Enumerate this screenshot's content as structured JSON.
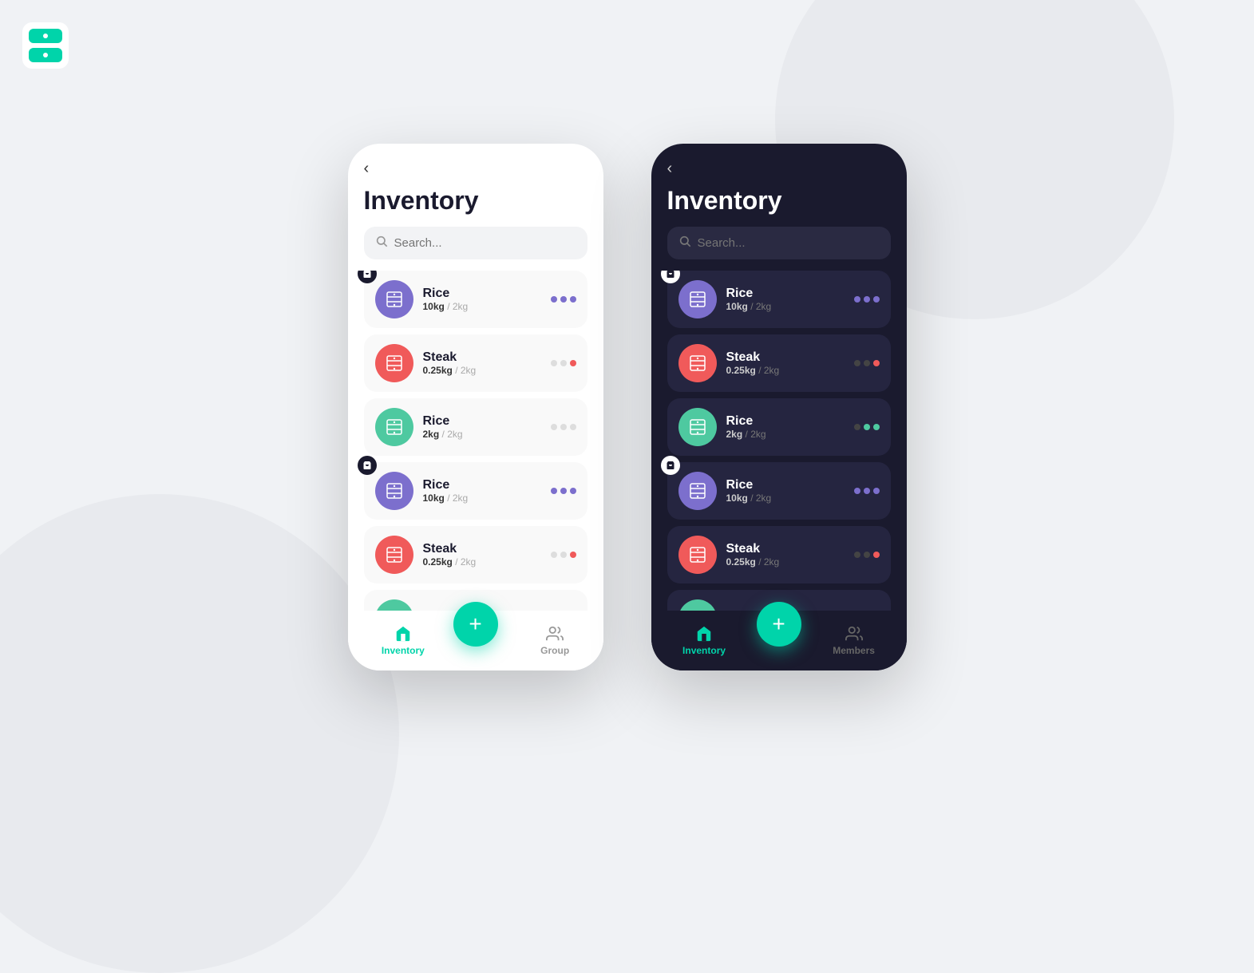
{
  "logo": {
    "label": "App Logo"
  },
  "light_phone": {
    "back_label": "‹",
    "title": "Inventory",
    "search_placeholder": "Search...",
    "items": [
      {
        "id": 1,
        "name": "Rice",
        "weight": "10kg",
        "unit": "2kg",
        "icon_bg": "#7c6fcd",
        "has_cart_badge": true,
        "dots": [
          {
            "color": "#7c6fcd"
          },
          {
            "color": "#7c6fcd"
          },
          {
            "color": "#7c6fcd"
          }
        ]
      },
      {
        "id": 2,
        "name": "Steak",
        "weight": "0.25kg",
        "unit": "2kg",
        "icon_bg": "#f05a5a",
        "has_cart_badge": false,
        "dots": [
          {
            "color": "#ccc"
          },
          {
            "color": "#ccc"
          },
          {
            "color": "#f05a5a"
          }
        ]
      },
      {
        "id": 3,
        "name": "Rice",
        "weight": "2kg",
        "unit": "2kg",
        "icon_bg": "#4ec9a0",
        "has_cart_badge": false,
        "dots": [
          {
            "color": "#ccc"
          },
          {
            "color": "#ccc"
          },
          {
            "color": "#ccc"
          }
        ]
      },
      {
        "id": 4,
        "name": "Rice",
        "weight": "10kg",
        "unit": "2kg",
        "icon_bg": "#7c6fcd",
        "has_cart_badge": true,
        "dots": [
          {
            "color": "#7c6fcd"
          },
          {
            "color": "#7c6fcd"
          },
          {
            "color": "#7c6fcd"
          }
        ]
      },
      {
        "id": 5,
        "name": "Steak",
        "weight": "0.25kg",
        "unit": "2kg",
        "icon_bg": "#f05a5a",
        "has_cart_badge": false,
        "dots": [
          {
            "color": "#ccc"
          },
          {
            "color": "#ccc"
          },
          {
            "color": "#f05a5a"
          }
        ]
      }
    ],
    "nav": {
      "inventory_label": "Inventory",
      "group_label": "Group"
    },
    "fab_label": "+"
  },
  "dark_phone": {
    "back_label": "‹",
    "title": "Inventory",
    "search_placeholder": "Search...",
    "items": [
      {
        "id": 1,
        "name": "Rice",
        "weight": "10kg",
        "unit": "2kg",
        "icon_bg": "#7c6fcd",
        "has_cart_badge": true,
        "dots": [
          {
            "color": "#7c6fcd"
          },
          {
            "color": "#7c6fcd"
          },
          {
            "color": "#7c6fcd"
          }
        ]
      },
      {
        "id": 2,
        "name": "Steak",
        "weight": "0.25kg",
        "unit": "2kg",
        "icon_bg": "#f05a5a",
        "has_cart_badge": false,
        "dots": [
          {
            "color": "#555"
          },
          {
            "color": "#555"
          },
          {
            "color": "#f05a5a"
          }
        ]
      },
      {
        "id": 3,
        "name": "Rice",
        "weight": "2kg",
        "unit": "2kg",
        "icon_bg": "#4ec9a0",
        "has_cart_badge": false,
        "dots": [
          {
            "color": "#555"
          },
          {
            "color": "#4ec9a0"
          },
          {
            "color": "#4ec9a0"
          }
        ]
      },
      {
        "id": 4,
        "name": "Rice",
        "weight": "10kg",
        "unit": "2kg",
        "icon_bg": "#7c6fcd",
        "has_cart_badge": true,
        "dots": [
          {
            "color": "#7c6fcd"
          },
          {
            "color": "#7c6fcd"
          },
          {
            "color": "#7c6fcd"
          }
        ]
      },
      {
        "id": 5,
        "name": "Steak",
        "weight": "0.25kg",
        "unit": "2kg",
        "icon_bg": "#f05a5a",
        "has_cart_badge": false,
        "dots": [
          {
            "color": "#555"
          },
          {
            "color": "#555"
          },
          {
            "color": "#f05a5a"
          }
        ]
      }
    ],
    "nav": {
      "inventory_label": "Inventory",
      "members_label": "Members"
    },
    "fab_label": "+"
  }
}
